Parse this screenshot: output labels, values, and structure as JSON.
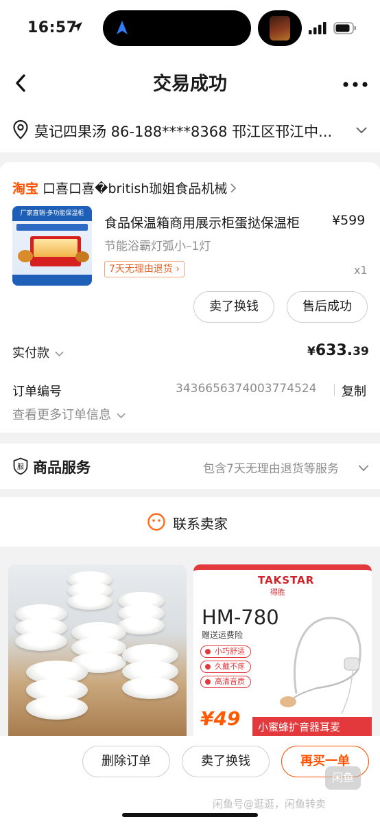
{
  "status_bar": {
    "time": "16:57"
  },
  "nav": {
    "title": "交易成功"
  },
  "address": {
    "text": "莫记四果汤 86-188****8368 邗江区邗江中..."
  },
  "order": {
    "platform": "淘宝",
    "shop_name": "口喜口喜�british珈姐食品机械",
    "product_title": "食品保温箱商用展示柜蛋挞保温柜",
    "price": "¥599",
    "spec": "节能浴霸灯弧小–1灯",
    "return_tag": "7天无理由退货",
    "quantity": "x1",
    "btn_sell": "卖了换钱",
    "btn_after_sale": "售后成功",
    "paid_label": "实付款",
    "paid_yen": "¥",
    "paid_int": "633.",
    "paid_dec": "39",
    "order_no_label": "订单编号",
    "order_no": "3436656374003774524",
    "copy_label": "复制",
    "more_info": "查看更多订单信息",
    "product_image": {
      "header": "厂家直销·多功能保温柜"
    }
  },
  "service": {
    "icon_text": "服",
    "title": "商品服务",
    "desc": "包含7天无理由退货等服务"
  },
  "contact": {
    "label": "联系卖家"
  },
  "recommend": {
    "right": {
      "brand": "TAKSTAR",
      "brand_cn": "得胜",
      "model": "HM-780",
      "gift": "赠送运费险",
      "features": [
        "小巧舒适",
        "久戴不疼",
        "高清音质"
      ],
      "price": "¥49",
      "banner": "小蜜蜂扩音器耳麦"
    }
  },
  "bottom": {
    "delete": "删除订单",
    "sell": "卖了换钱",
    "rebuy": "再买一单",
    "watermark_icon": "闲鱼",
    "watermark_text": "闲鱼号@逛逛，闲鱼转卖"
  },
  "colors": {
    "accent": "#ff5000",
    "muted": "#8c8c8c"
  }
}
